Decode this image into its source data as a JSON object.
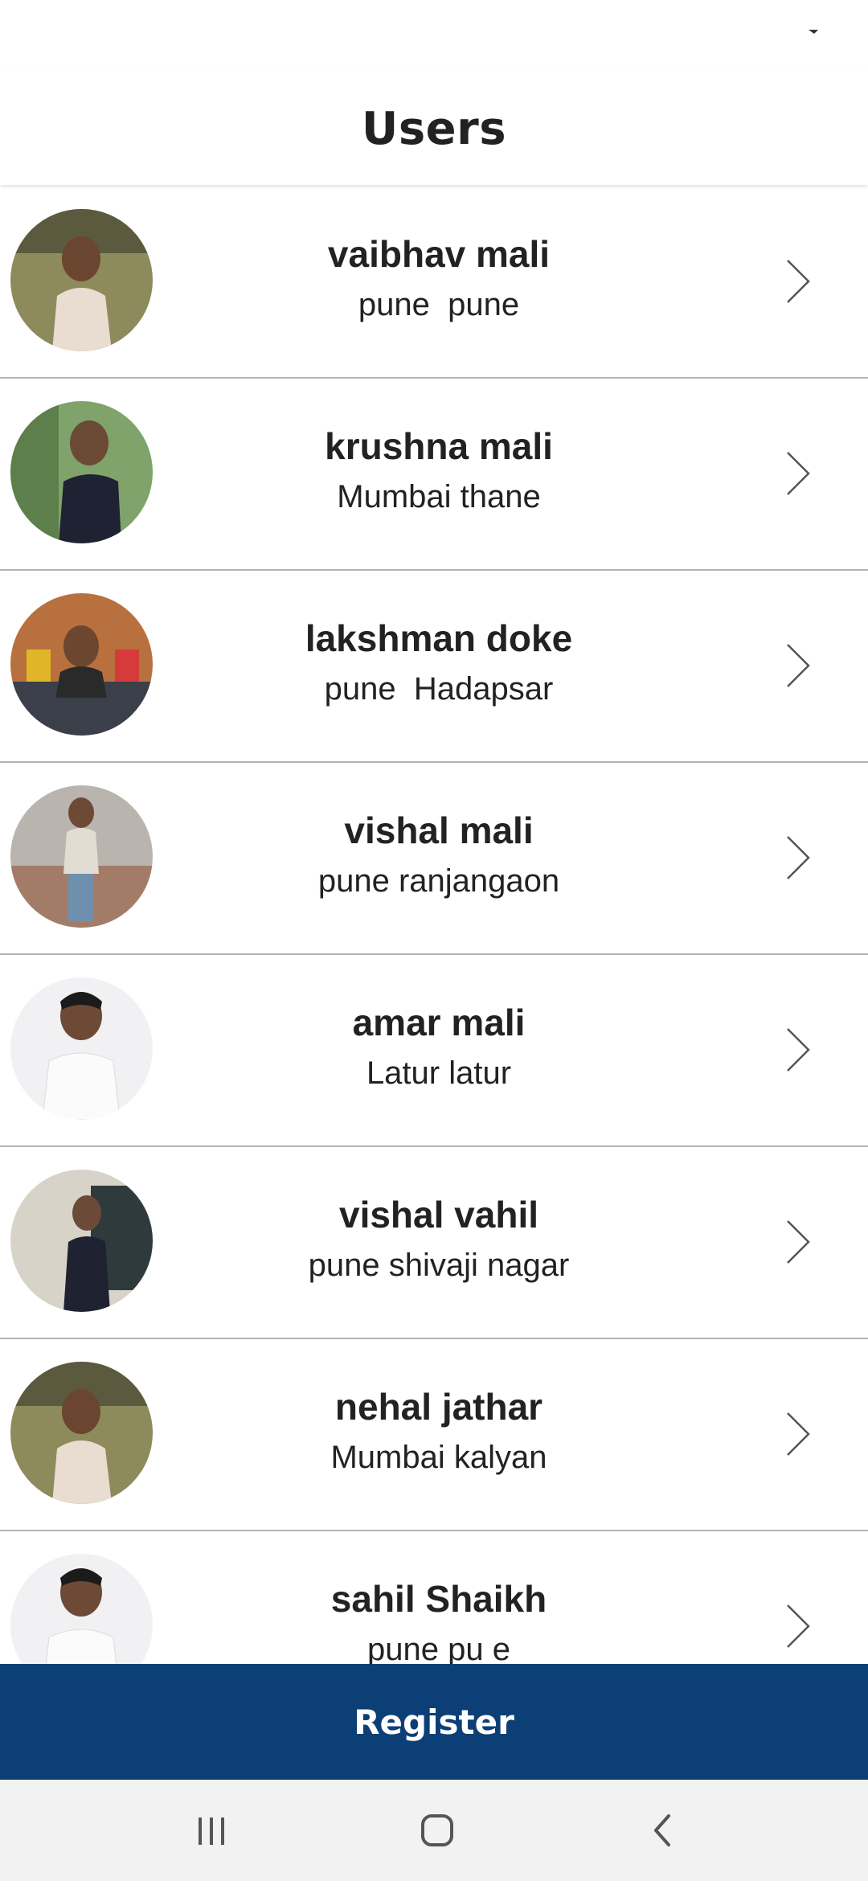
{
  "header": {
    "title": "Users"
  },
  "users": [
    {
      "name": "vaibhav mali",
      "location": "pune  pune"
    },
    {
      "name": "krushna mali",
      "location": "Mumbai thane"
    },
    {
      "name": "lakshman doke",
      "location": "pune  Hadapsar"
    },
    {
      "name": "vishal mali",
      "location": "pune ranjangaon"
    },
    {
      "name": "amar mali",
      "location": "Latur latur"
    },
    {
      "name": "vishal vahil",
      "location": "pune shivaji nagar"
    },
    {
      "name": "nehal jathar",
      "location": "Mumbai kalyan"
    },
    {
      "name": "sahil Shaikh",
      "location": "pune pu e"
    }
  ],
  "footer": {
    "register_label": "Register"
  },
  "nav": {
    "recents_icon": "recent-apps-icon",
    "home_icon": "home-icon",
    "back_icon": "back-icon"
  },
  "colors": {
    "primary": "#0d3f77",
    "divider": "#b3b3b3",
    "text": "#222222",
    "nav_bar": "#f2f2f2"
  }
}
